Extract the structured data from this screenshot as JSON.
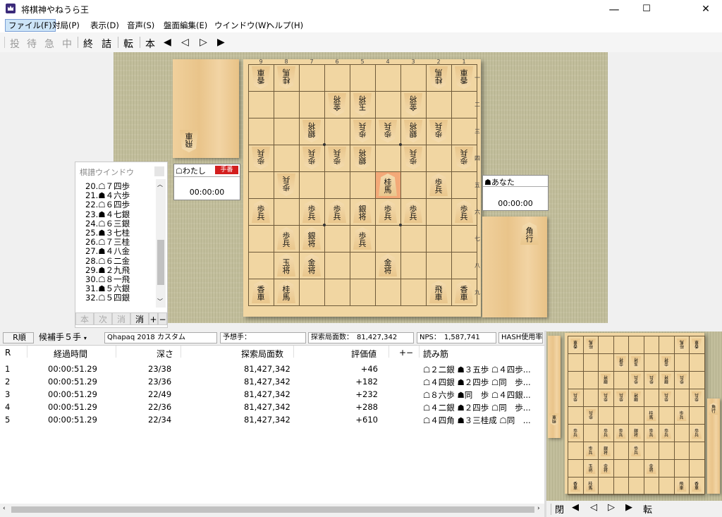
{
  "window": {
    "title": "将棋神やねうら王",
    "min": "—",
    "max": "☐",
    "close": "✕"
  },
  "menu": [
    "ファイル(F)",
    "対局(P)",
    "表示(D)",
    "音声(S)",
    "盤面編集(E)",
    "ウインドウ(W)",
    "ヘルプ(H)"
  ],
  "toolbar": {
    "resign": "投",
    "wait": "待",
    "urgent": "急",
    "stop": "中",
    "end": "終",
    "mate": "詰",
    "flip": "転",
    "main": "本",
    "first": "◀",
    "prev": "◁",
    "next": "▷",
    "last": "▶"
  },
  "board": {
    "file_labels": [
      "9",
      "8",
      "7",
      "6",
      "5",
      "4",
      "3",
      "2",
      "1"
    ],
    "rank_labels": [
      "一",
      "二",
      "三",
      "四",
      "五",
      "六",
      "七",
      "八",
      "九"
    ],
    "pieces": [
      {
        "r": 1,
        "c": 1,
        "t": "香車",
        "g": true
      },
      {
        "r": 1,
        "c": 2,
        "t": "桂馬",
        "g": true
      },
      {
        "r": 1,
        "c": 8,
        "t": "桂馬",
        "g": true
      },
      {
        "r": 1,
        "c": 9,
        "t": "香車",
        "g": true
      },
      {
        "r": 2,
        "c": 4,
        "t": "金将",
        "g": true
      },
      {
        "r": 2,
        "c": 5,
        "t": "玉将",
        "g": true
      },
      {
        "r": 2,
        "c": 7,
        "t": "金将",
        "g": true
      },
      {
        "r": 3,
        "c": 3,
        "t": "銀将",
        "g": true
      },
      {
        "r": 3,
        "c": 5,
        "t": "歩兵",
        "g": true
      },
      {
        "r": 3,
        "c": 6,
        "t": "歩兵",
        "g": true
      },
      {
        "r": 3,
        "c": 7,
        "t": "銀将",
        "g": true
      },
      {
        "r": 3,
        "c": 8,
        "t": "歩兵",
        "g": true
      },
      {
        "r": 4,
        "c": 1,
        "t": "歩兵",
        "g": true
      },
      {
        "r": 4,
        "c": 3,
        "t": "歩兵",
        "g": true
      },
      {
        "r": 4,
        "c": 4,
        "t": "歩兵",
        "g": true
      },
      {
        "r": 4,
        "c": 5,
        "t": "銀将",
        "g": true
      },
      {
        "r": 4,
        "c": 7,
        "t": "歩兵",
        "g": true
      },
      {
        "r": 4,
        "c": 9,
        "t": "歩兵",
        "g": true
      },
      {
        "r": 5,
        "c": 2,
        "t": "歩兵",
        "g": true
      },
      {
        "r": 5,
        "c": 6,
        "t": "桂馬",
        "g": false
      },
      {
        "r": 5,
        "c": 8,
        "t": "歩兵",
        "g": false
      },
      {
        "r": 6,
        "c": 1,
        "t": "歩兵",
        "g": false
      },
      {
        "r": 6,
        "c": 3,
        "t": "歩兵",
        "g": false
      },
      {
        "r": 6,
        "c": 4,
        "t": "歩兵",
        "g": false
      },
      {
        "r": 6,
        "c": 5,
        "t": "銀将",
        "g": false
      },
      {
        "r": 6,
        "c": 6,
        "t": "歩兵",
        "g": false
      },
      {
        "r": 6,
        "c": 7,
        "t": "歩兵",
        "g": false
      },
      {
        "r": 6,
        "c": 9,
        "t": "歩兵",
        "g": false
      },
      {
        "r": 7,
        "c": 2,
        "t": "歩兵",
        "g": false
      },
      {
        "r": 7,
        "c": 3,
        "t": "銀将",
        "g": false
      },
      {
        "r": 7,
        "c": 5,
        "t": "歩兵",
        "g": false
      },
      {
        "r": 8,
        "c": 2,
        "t": "玉将",
        "g": false
      },
      {
        "r": 8,
        "c": 3,
        "t": "金将",
        "g": false
      },
      {
        "r": 8,
        "c": 6,
        "t": "金将",
        "g": false
      },
      {
        "r": 9,
        "c": 1,
        "t": "香車",
        "g": false
      },
      {
        "r": 9,
        "c": 2,
        "t": "桂馬",
        "g": false
      },
      {
        "r": 9,
        "c": 8,
        "t": "飛車",
        "g": false
      },
      {
        "r": 9,
        "c": 9,
        "t": "香車",
        "g": false
      }
    ],
    "gote_hand": "飛車",
    "sente_hand": "角行",
    "gote_player": "☖わたし",
    "gote_badge": "手番",
    "gote_time": "00:00:00",
    "sente_player": "☗あなた",
    "sente_time": "00:00:00"
  },
  "kifu": {
    "title": "棋譜ウインドウ",
    "moves": [
      "20.☖７四歩",
      "21.☗４六歩",
      "22.☖６四歩",
      "23.☗４七銀",
      "24.☖６三銀",
      "25.☗３七桂",
      "26.☖７三桂",
      "27.☗４八金",
      "28.☖６二金",
      "29.☗２九飛",
      "30.☖８一飛",
      "31.☗５六銀",
      "32.☖５四銀"
    ],
    "buttons": [
      "本",
      "次",
      "消",
      "消",
      "+",
      "−"
    ]
  },
  "engine": {
    "r_label": "R順",
    "candidate": "候補手５手",
    "name": "Qhapaq 2018 カスタム",
    "predict": "予想手：",
    "nodes": "探索局面数：　81,427,342",
    "nps": "NPS：　1,587,741",
    "hash": "HASH使用率",
    "headers": [
      "R",
      "経過時間",
      "深さ",
      "探索局面数",
      "評価値",
      "+−",
      "読み筋"
    ],
    "rows": [
      [
        "1",
        "00:00:51.29",
        "23/38",
        "81,427,342",
        "+46",
        "",
        "☖２二銀 ☗３五歩 ☖４四歩..."
      ],
      [
        "2",
        "00:00:51.29",
        "23/36",
        "81,427,342",
        "+182",
        "",
        "☖４四銀 ☗２四歩 ☖同　歩..."
      ],
      [
        "3",
        "00:00:51.29",
        "22/49",
        "81,427,342",
        "+232",
        "",
        "☖８六歩 ☗同　歩 ☖４四銀..."
      ],
      [
        "4",
        "00:00:51.29",
        "22/36",
        "81,427,342",
        "+288",
        "",
        "☖４二銀 ☗２四歩 ☖同　歩..."
      ],
      [
        "5",
        "00:00:51.29",
        "22/34",
        "81,427,342",
        "+610",
        "",
        "☖４四角 ☗３三桂成 ☖同　..."
      ]
    ]
  },
  "minibar": {
    "close": "閉",
    "first": "◀",
    "prev": "◁",
    "next": "▷",
    "last": "▶",
    "flip": "転"
  }
}
